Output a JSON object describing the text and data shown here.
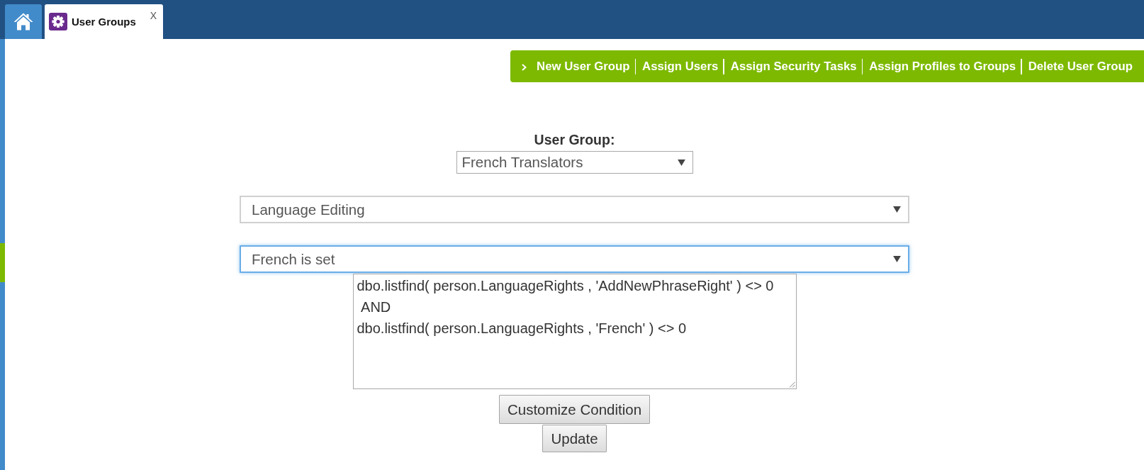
{
  "tabs": [
    {
      "kind": "home",
      "selected": false
    },
    {
      "kind": "page",
      "label": "User Groups",
      "close": "X",
      "selected": true
    }
  ],
  "actions": [
    "New User Group",
    "Assign Users",
    "Assign Security Tasks",
    "Assign Profiles to Groups",
    "Delete User Group"
  ],
  "form": {
    "user_group_label": "User Group:",
    "user_group": "French Translators",
    "selects": [
      {
        "value": "Language Editing",
        "focused": false
      },
      {
        "value": "French is set",
        "focused": true
      }
    ],
    "condition": "dbo.listfind( person.LanguageRights , 'AddNewPhraseRight' ) <> 0\n AND\ndbo.listfind( person.LanguageRights , 'French' ) <> 0",
    "buttons": [
      "Customize Condition",
      "Update"
    ]
  }
}
